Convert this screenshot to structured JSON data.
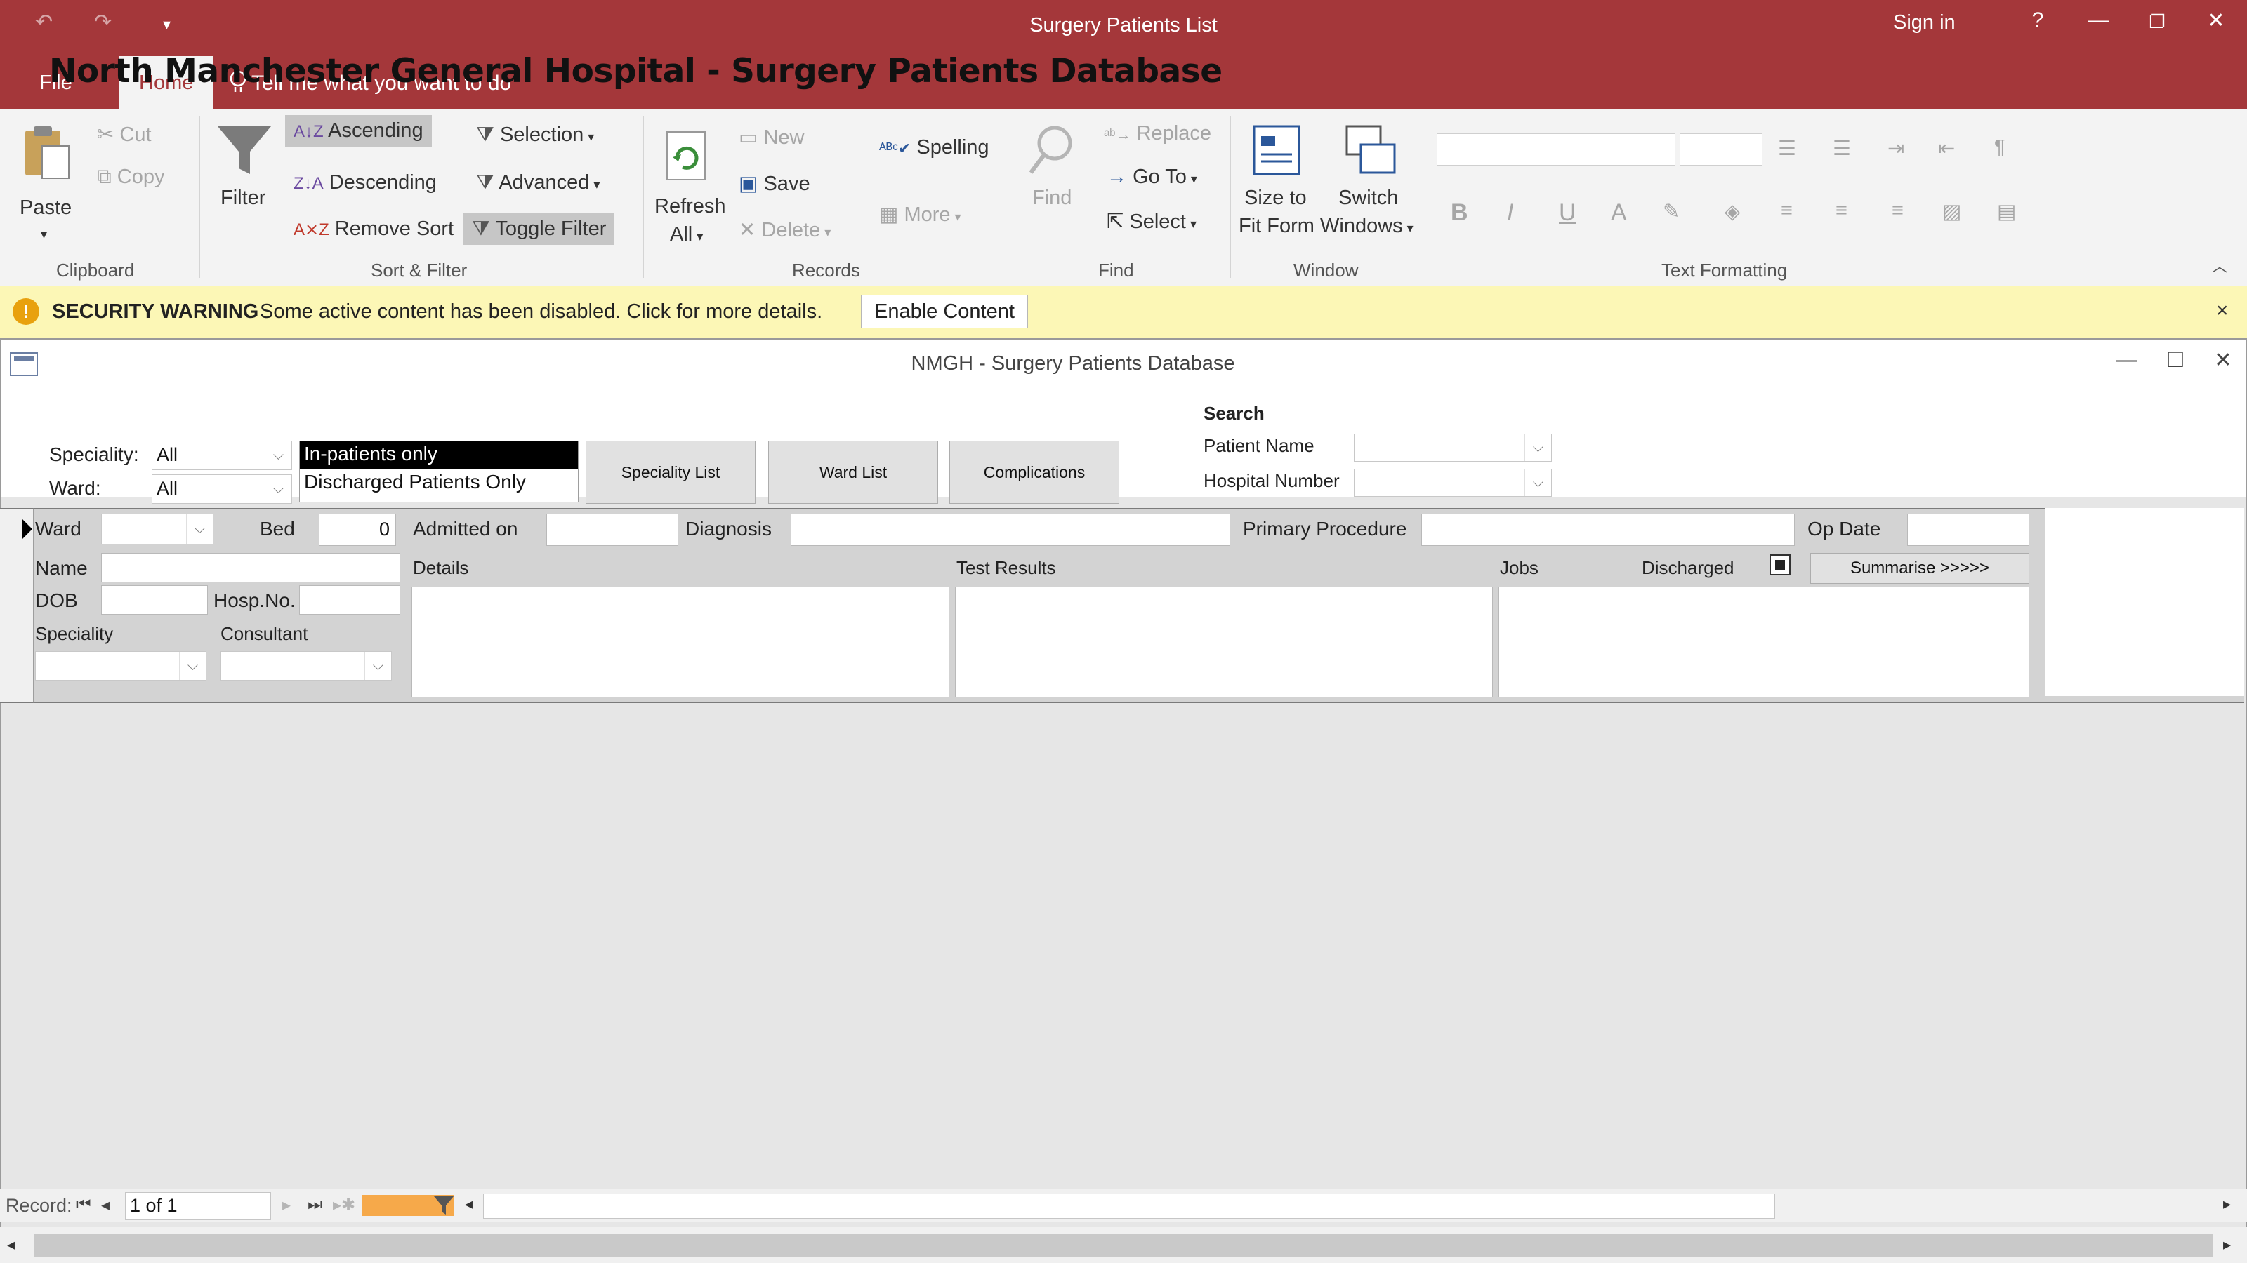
{
  "app": {
    "title": "Surgery Patients List",
    "sign_in": "Sign in",
    "help": "?",
    "qat_undo": "↶",
    "qat_redo": "↷",
    "qat_customize": "▾",
    "win_minimize": "—",
    "win_restore": "❐",
    "win_close": "✕"
  },
  "tabs": {
    "file": "File",
    "home": "Home",
    "tell_me": "Tell me what you want to do"
  },
  "ribbon": {
    "clipboard": {
      "paste": "Paste",
      "cut": "Cut",
      "copy": "Copy",
      "group": "Clipboard"
    },
    "sort_filter": {
      "filter": "Filter",
      "ascending": "Ascending",
      "descending": "Descending",
      "remove_sort": "Remove Sort",
      "selection": "Selection",
      "advanced": "Advanced",
      "toggle_filter": "Toggle Filter",
      "group": "Sort & Filter"
    },
    "records": {
      "refresh": "Refresh",
      "refresh_all": "All",
      "new": "New",
      "save": "Save",
      "delete": "Delete",
      "spelling": "Spelling",
      "more": "More",
      "group": "Records"
    },
    "find": {
      "find": "Find",
      "replace": "Replace",
      "goto": "Go To",
      "select": "Select",
      "group": "Find"
    },
    "window": {
      "size_to": "Size to",
      "fit_form": "Fit Form",
      "switch": "Switch",
      "windows": "Windows",
      "group": "Window"
    },
    "text_formatting": {
      "group": "Text Formatting",
      "bold": "B",
      "italic": "I",
      "underline": "U",
      "font_color": "A"
    }
  },
  "security": {
    "title": "SECURITY WARNING",
    "message": "Some active content has been disabled. Click for more details.",
    "enable": "Enable Content",
    "close": "×"
  },
  "form": {
    "title": "NMGH - Surgery Patients Database",
    "heading": "North Manchester General Hospital - Surgery Patients Database",
    "speciality_label": "Speciality:",
    "speciality_value": "All",
    "ward_label": "Ward:",
    "ward_value": "All",
    "list_options": [
      "In-patients only",
      "Discharged Patients Only"
    ],
    "buttons": {
      "speciality_list": "Speciality List",
      "ward_list": "Ward List",
      "complications": "Complications"
    },
    "search": {
      "title": "Search",
      "patient_name": "Patient Name",
      "hospital_number": "Hospital Number"
    }
  },
  "record": {
    "ward": "Ward",
    "bed": "Bed",
    "bed_value": "0",
    "admitted_on": "Admitted on",
    "diagnosis": "Diagnosis",
    "primary_procedure": "Primary Procedure",
    "op_date": "Op Date",
    "name": "Name",
    "dob": "DOB",
    "hosp_no": "Hosp.No.",
    "speciality": "Speciality",
    "consultant": "Consultant",
    "details": "Details",
    "test_results": "Test Results",
    "jobs": "Jobs",
    "discharged": "Discharged",
    "summarise": "Summarise >>>>>"
  },
  "nav": {
    "label": "Record:",
    "position": "1 of 1"
  }
}
